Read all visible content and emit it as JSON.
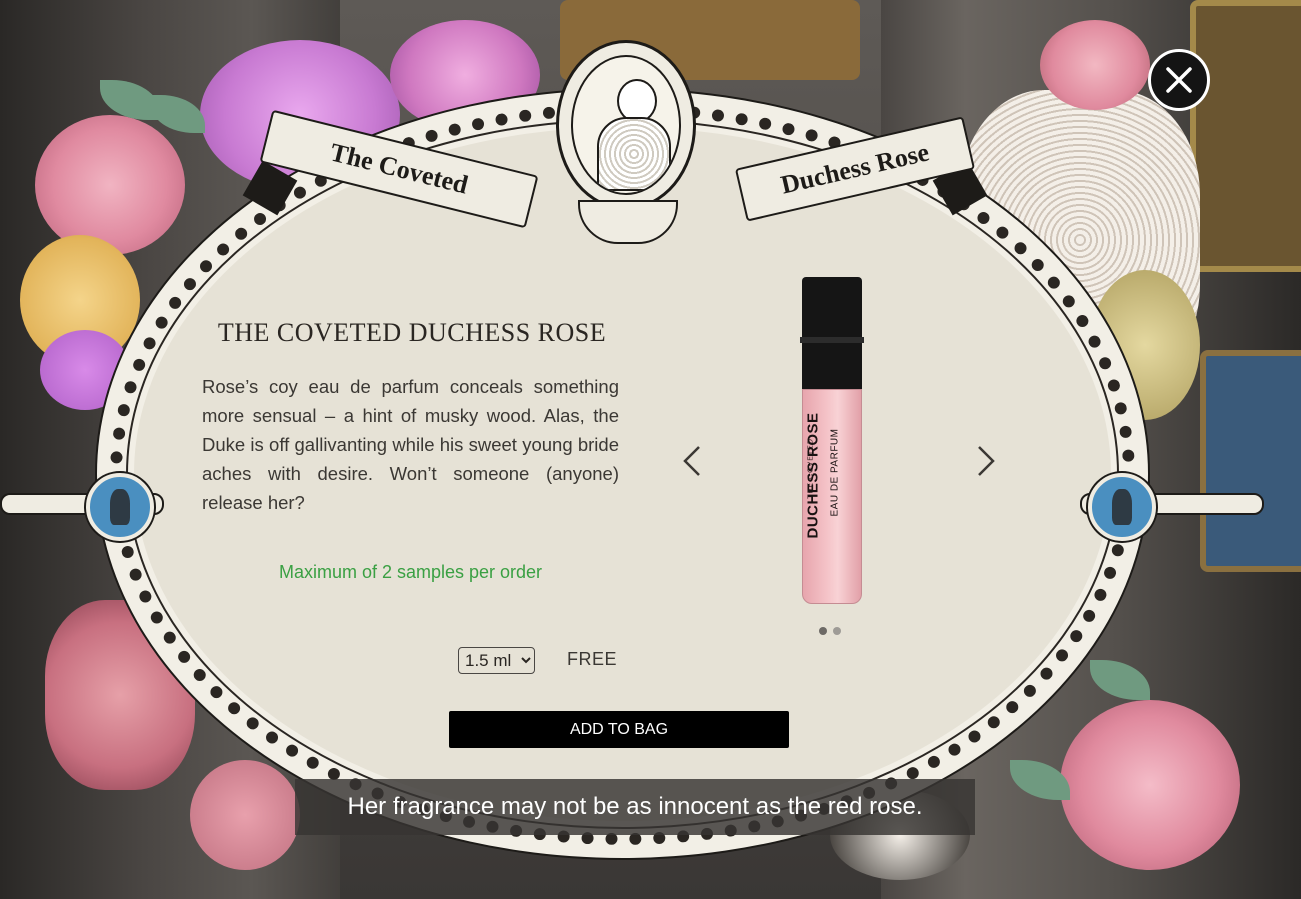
{
  "banner": {
    "left_text": "The Coveted",
    "right_text": "Duchess Rose"
  },
  "product": {
    "title": "THE COVETED DUCHESS ROSE",
    "description": "Rose’s coy eau de parfum conceals something more sensual – a hint of musky wood. Alas, the Duke is off gallivanting while his sweet young bride aches with desire. Won’t someone (anyone) release her?",
    "limit_note": "Maximum of 2 samples per order",
    "size_selected": "1.5 ml",
    "price": "FREE",
    "add_to_bag_label": "ADD TO BAG"
  },
  "vial": {
    "brand": "THE COVETED",
    "name": "DUCHESS ROSE",
    "sub": "EAU DE PARFUM"
  },
  "carousel": {
    "slide_count": 2,
    "active_slide": 1
  },
  "caption": {
    "text": "Her fragrance may not be as innocent as the red rose."
  },
  "colors": {
    "accent_green": "#3aa043",
    "plaque_bg": "#e6e2d6",
    "button_bg": "#000000"
  },
  "icons": {
    "close": "close-icon",
    "prev": "chevron-left-icon",
    "next": "chevron-right-icon"
  }
}
